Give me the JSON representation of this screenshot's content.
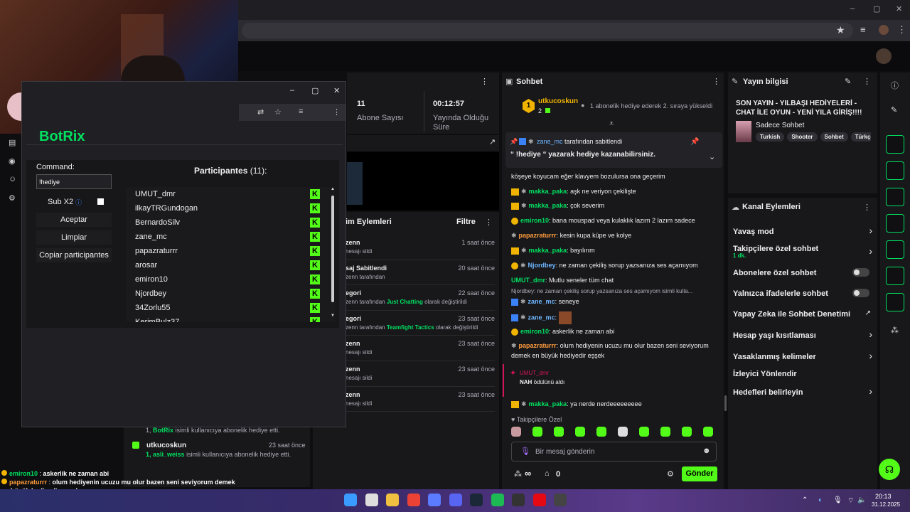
{
  "stream": {
    "subs_value": "11",
    "subs_label": "Abone Sayısı",
    "uptime_value": "00:12:57",
    "uptime_label": "Yayında Olduğu Süre"
  },
  "events": {
    "title": "im Eylemleri",
    "filter": "Filtre",
    "items": [
      {
        "name": "zenn",
        "desc": "nesajı sildi",
        "time": "1 saat önce",
        "hl": "",
        "tail": ""
      },
      {
        "name": "saj Sabitlendi",
        "desc": "zenn tarafından",
        "time": "20 saat önce",
        "hl": "",
        "tail": ""
      },
      {
        "name": "egori",
        "desc": "zenn tarafından ",
        "time": "22 saat önce",
        "hl": "Just Chatting",
        "tail": " olarak değiştirildi"
      },
      {
        "name": "egori",
        "desc": "zenn tarafından ",
        "time": "23 saat önce",
        "hl": "Teamfight Tactics",
        "tail": " olarak değiştirildi"
      },
      {
        "name": "zenn",
        "desc": "nesajı sildi",
        "time": "23 saat önce",
        "hl": "",
        "tail": ""
      },
      {
        "name": "zenn",
        "desc": "nesajı sildi",
        "time": "23 saat önce",
        "hl": "",
        "tail": ""
      },
      {
        "name": "zenn",
        "desc": "nesajı sildi",
        "time": "23 saat önce",
        "hl": "",
        "tail": ""
      }
    ],
    "sub_gift1": {
      "prefix": "1, ",
      "user": "BotRix",
      "text": " isimli kullanıcıya abonelik hediye etti."
    },
    "sub_gift2": {
      "name": "utkucoskun",
      "time": "23 saat önce",
      "prefix": "1, ",
      "user": "asli_weiss",
      "text": " isimli kullanıcıya abonelik hediye etti."
    }
  },
  "botrix": {
    "title": "BotRix",
    "command_label": "Command:",
    "command_value": "!hediye",
    "sub_label": "Sub X2",
    "btn_accept": "Aceptar",
    "btn_clear": "Limpiar",
    "btn_copy": "Copiar participantes",
    "participants_title": "Participantes",
    "participants_count": "(11):",
    "participants": [
      "UMUT_dmr",
      "ilkayTRGundogan",
      "BernardoSilv",
      "zane_mc",
      "papazraturrr",
      "arosar",
      "emiron10",
      "Njordbey",
      "34Zorlu55",
      "KerimBulz37"
    ]
  },
  "chat": {
    "title": "Sohbet",
    "gifter": {
      "name": "utkucoskun",
      "count": "2",
      "text": "1 abonelik hediye ederek 2. sıraya yükseldi"
    },
    "pinned": {
      "user": "zane_mc",
      "suffix": " tarafından sabitlendi",
      "text": "“ !hediye “ yazarak hediye kazanabilirsiniz."
    },
    "top_line": "köşeye koyucam eğer klavyem bozulursa ona geçerim",
    "messages": [
      {
        "user": "makka_paka",
        "color": "#00e060",
        "text": "aşk ne veriyon çekilişte"
      },
      {
        "user": "makka_paka",
        "color": "#00e060",
        "text": "çok severim"
      },
      {
        "user": "emiron10",
        "color": "#00e060",
        "text": "bana mouspad veya kulaklık lazım 2 lazım sadece"
      },
      {
        "user": "papazraturrr",
        "color": "#ff9d3c",
        "text": "kesin kupa küpe ve kolye"
      },
      {
        "user": "makka_paka",
        "color": "#00e060",
        "text": "bayılırım"
      },
      {
        "user": "Njordbey",
        "color": "#6fb7ff",
        "text": "ne zaman çekiliş sorup yazsanıza ses açamıyom"
      },
      {
        "user": "UMUT_dmr",
        "color": "#00e060",
        "text": "Mutlu seneler tüm chat"
      },
      {
        "user": "zane_mc",
        "color": "#6fb7ff",
        "text": "seneye"
      },
      {
        "user": "zane_mc",
        "color": "#6fb7ff",
        "text": ""
      },
      {
        "user": "emiron10",
        "color": "#00e060",
        "text": "askerlik ne zaman abi"
      },
      {
        "user": "papazraturrr",
        "color": "#ff9d3c",
        "text": "olum hediyenin ucuzu mu olur bazen seni seviyorum demek en büyük hediyedir eşşek"
      },
      {
        "user": "makka_paka",
        "color": "#00e060",
        "text": "ya nerde nerdeeeeeeeee"
      }
    ],
    "reply": "Njordbey: ne zaman çekiliş sorup yazsanıza ses açamıyom isimli kulla...",
    "redeem": {
      "user": "UMUT_dmr",
      "item": "NAH",
      "text": " ödülünü aldı"
    },
    "followers_only": "Takipçilere Özel",
    "input_placeholder": "Bir mesaj gönderin",
    "infinity": "∞",
    "points": "0",
    "send": "Gönder"
  },
  "info": {
    "title": "Yayın bilgisi",
    "stream_title": "SON YAYIN - YILBAŞI HEDİYELERİ - CHAT İLE OYUN - YENİ YILA GİRİŞ!!!! !hediye...",
    "category": "Sadece Sohbet",
    "tags": [
      "Turkish",
      "Shooter",
      "Sohbet",
      "Türkçe"
    ]
  },
  "channel": {
    "title": "Kanal Eylemleri",
    "slow": "Yavaş mod",
    "followers": "Takipçilere özel sohbet",
    "followers_sub": "1 dk.",
    "subs": "Abonelere özel sohbet",
    "emotes": "Yalnızca ifadelerle sohbet",
    "ai": "Yapay Zeka ile Sohbet Denetimi",
    "age": "Hesap yaşı kısıtlaması",
    "banned": "Yasaklanmış kelimeler",
    "redirect": "İzleyici Yönlendir",
    "goals": "Hedefleri belirleyin"
  },
  "overlay": [
    {
      "user": "emiron10",
      "color": "#00e060",
      "text": "askerlik ne zaman abi"
    },
    {
      "user": "papazraturrr",
      "color": "#ff9d3c",
      "text": "olum hediyenin ucuzu mu olur bazen seni seviyorum demek en büyük hediyedir eşşek"
    },
    {
      "user": "makka_paka",
      "color": "#00e060",
      "text": "ya nerde nerdeeeeeeeee"
    }
  ],
  "taskbar": {
    "time": "20:13",
    "date": "31.12.2025"
  }
}
